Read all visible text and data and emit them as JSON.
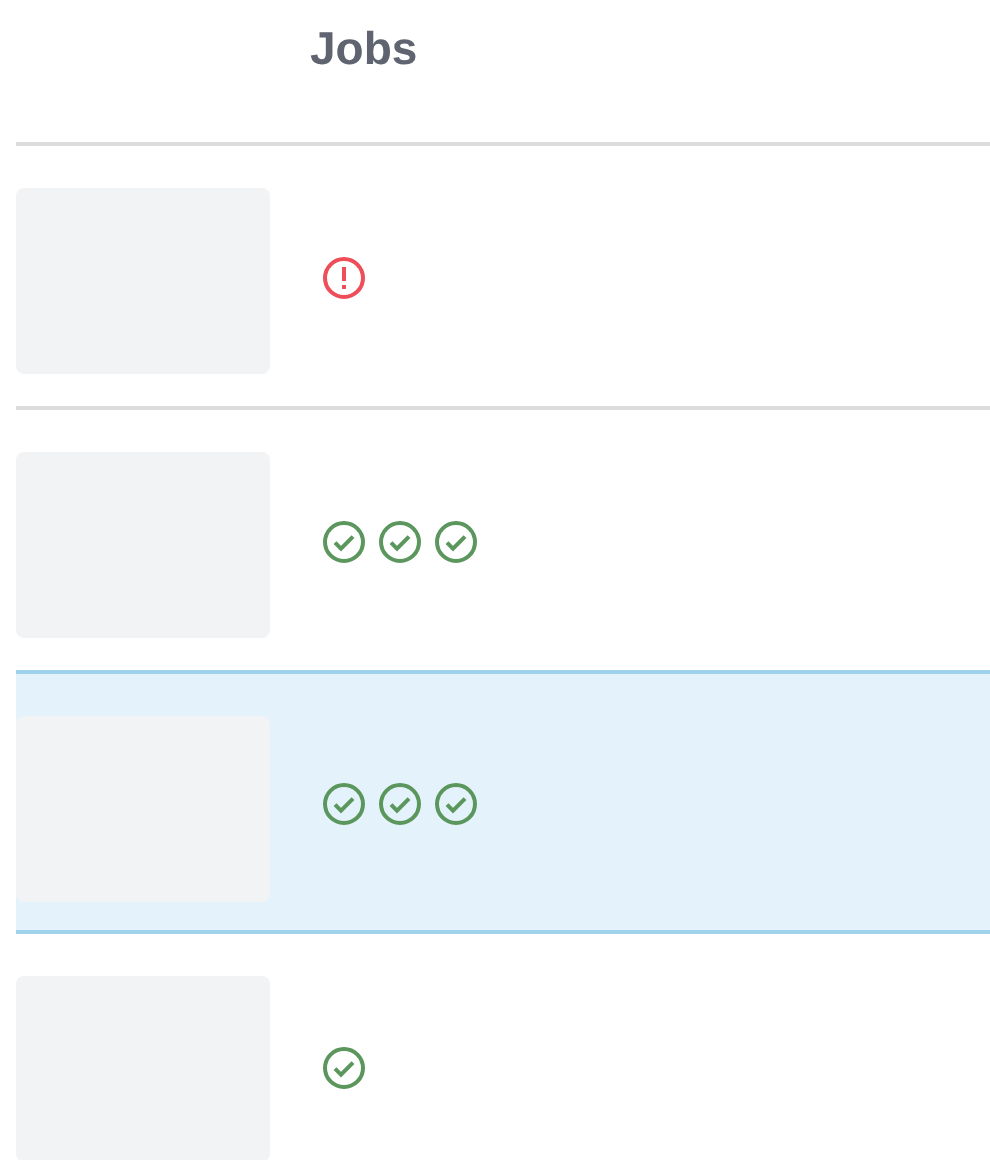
{
  "header": {
    "title": "Jobs"
  },
  "rows": [
    {
      "selected": false,
      "jobs": [
        {
          "kind": "error"
        }
      ]
    },
    {
      "selected": false,
      "jobs": [
        {
          "kind": "success"
        },
        {
          "kind": "success"
        },
        {
          "kind": "success"
        }
      ]
    },
    {
      "selected": true,
      "jobs": [
        {
          "kind": "success"
        },
        {
          "kind": "success"
        },
        {
          "kind": "success"
        }
      ]
    },
    {
      "selected": false,
      "jobs": [
        {
          "kind": "success"
        }
      ]
    }
  ]
}
